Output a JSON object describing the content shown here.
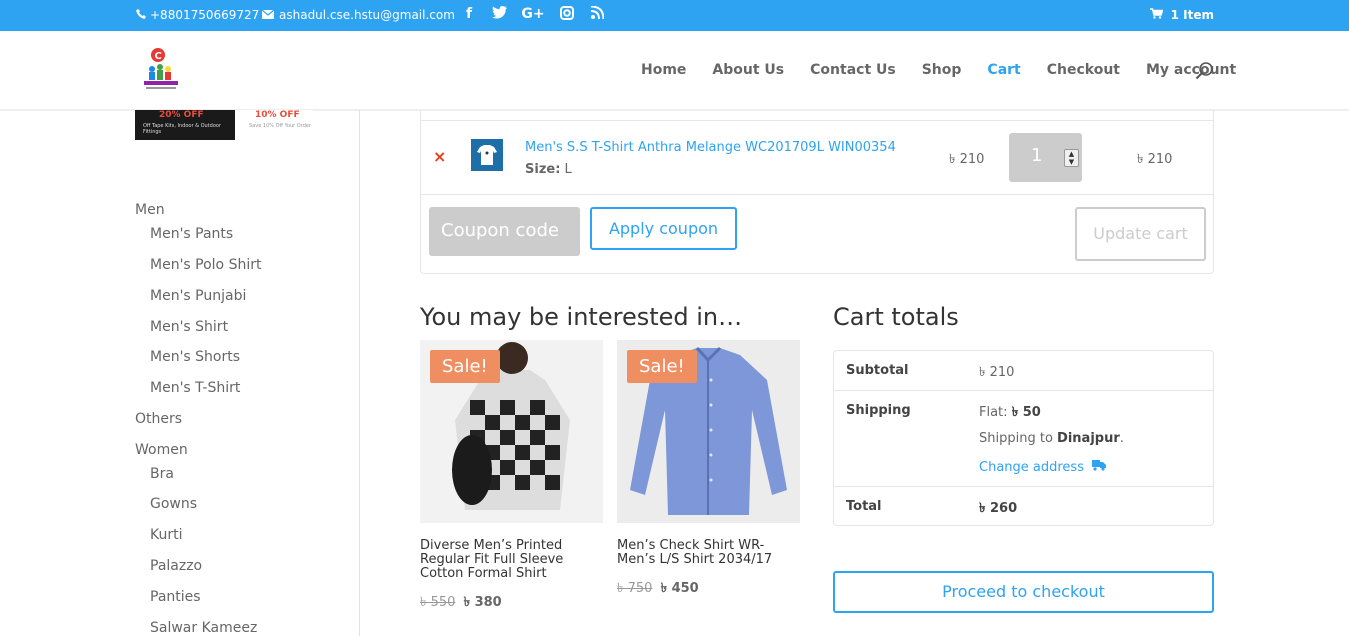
{
  "topbar": {
    "phone": "+8801750669727",
    "email": "ashadul.cse.hstu@gmail.com",
    "social_icons": [
      "facebook-icon",
      "twitter-icon",
      "google-plus-icon",
      "instagram-icon",
      "rss-icon"
    ],
    "cart_label": "1 Item"
  },
  "nav": {
    "items": [
      "Home",
      "About Us",
      "Contact Us",
      "Shop",
      "Cart",
      "Checkout",
      "My account"
    ],
    "active": "Cart"
  },
  "sidebar": {
    "categories": [
      {
        "label": "Men",
        "level": 0
      },
      {
        "label": "Men's Pants",
        "level": 1
      },
      {
        "label": "Men's Polo Shirt",
        "level": 1
      },
      {
        "label": "Men's Punjabi",
        "level": 1
      },
      {
        "label": "Men's Shirt",
        "level": 1
      },
      {
        "label": "Men's Shorts",
        "level": 1
      },
      {
        "label": "Men's T-Shirt",
        "level": 1
      },
      {
        "label": "Others",
        "level": 0
      },
      {
        "label": "Women",
        "level": 0
      },
      {
        "label": "Bra",
        "level": 1
      },
      {
        "label": "Gowns",
        "level": 1
      },
      {
        "label": "Kurti",
        "level": 1
      },
      {
        "label": "Palazzo",
        "level": 1
      },
      {
        "label": "Panties",
        "level": 1
      },
      {
        "label": "Salwar Kameez",
        "level": 1
      }
    ]
  },
  "cart": {
    "item": {
      "name": "Men's S.S T-Shirt Anthra Melange WC201709L WIN00354",
      "size_label": "Size:",
      "size_value": "L",
      "price": "৳ 210",
      "quantity": "1",
      "subtotal": "৳ 210"
    },
    "remove_symbol": "×",
    "coupon_placeholder": "Coupon code",
    "apply_label": "Apply coupon",
    "update_label": "Update cart"
  },
  "interested": {
    "title": "You may be interested in…",
    "products": [
      {
        "badge": "Sale!",
        "title": "Diverse Men’s Printed Regular Fit Full Sleeve Cotton Formal Shirt",
        "old_price": "৳ 550",
        "new_price": "৳ 380"
      },
      {
        "badge": "Sale!",
        "title": "Men’s Check Shirt WR-Men’s L/S Shirt 2034/17",
        "old_price": "৳ 750",
        "new_price": "৳ 450"
      }
    ]
  },
  "totals": {
    "title": "Cart totals",
    "subtotal_label": "Subtotal",
    "subtotal_value": "৳ 210",
    "shipping_label": "Shipping",
    "shipping_flat_prefix": "Flat:",
    "shipping_flat_value": "৳ 50",
    "shipping_to_prefix": "Shipping to",
    "shipping_to_value": "Dinajpur",
    "shipping_to_suffix": ".",
    "change_address": "Change address",
    "total_label": "Total",
    "total_value": "৳ 260",
    "checkout_label": "Proceed to checkout"
  },
  "colors": {
    "accent": "#2ea3f2",
    "sale_badge": "#ef8f61",
    "remove": "#e2401c"
  }
}
